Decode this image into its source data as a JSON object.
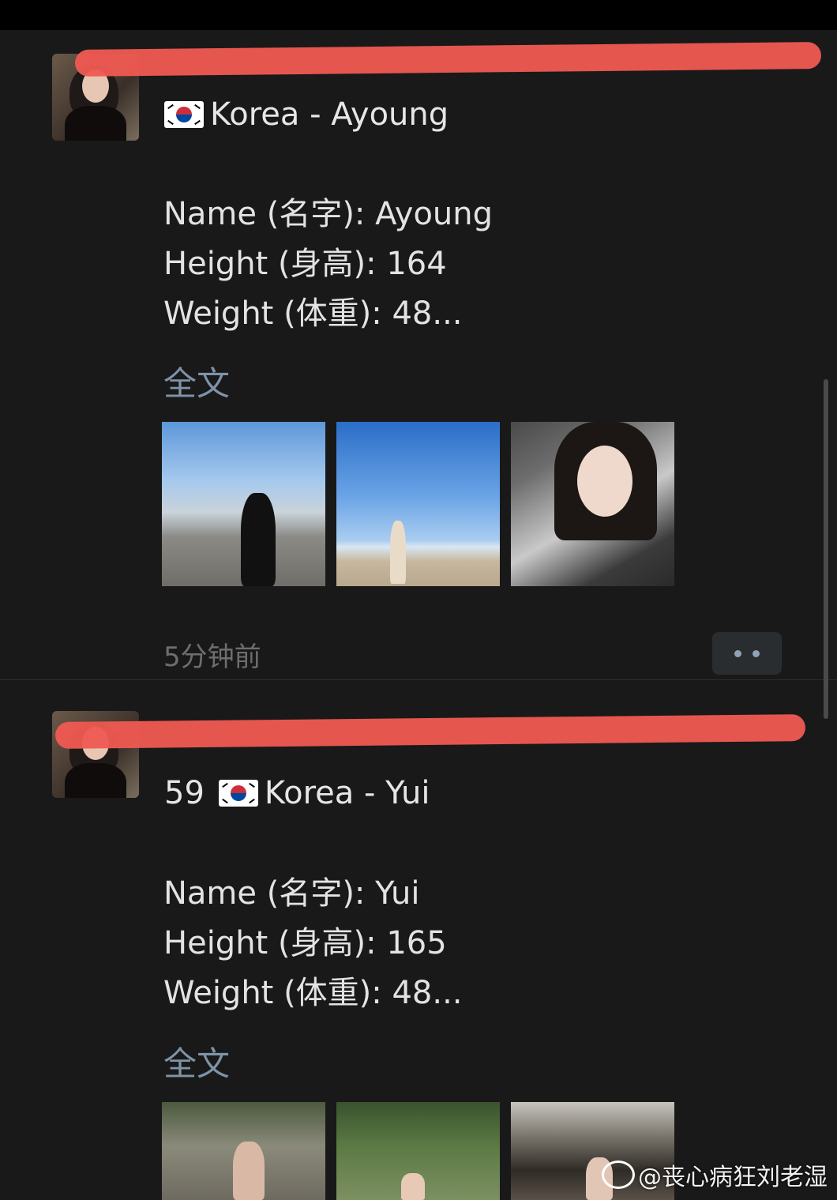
{
  "post1": {
    "title": "Korea - Ayoung",
    "details": [
      "Name (名字): Ayoung",
      "Height (身高): 164",
      "Weight (体重): 48..."
    ],
    "fulltext_link": "全文",
    "timestamp": "5分钟前"
  },
  "post2": {
    "number": "59",
    "title": "Korea - Yui",
    "details": [
      "Name (名字): Yui",
      "Height (身高): 165",
      "Weight (体重): 48..."
    ],
    "fulltext_link": "全文"
  },
  "watermark": "@丧心病狂刘老湿",
  "colors": {
    "background": "#191919",
    "link": "#7f93a8",
    "redaction": "#f05a52"
  }
}
